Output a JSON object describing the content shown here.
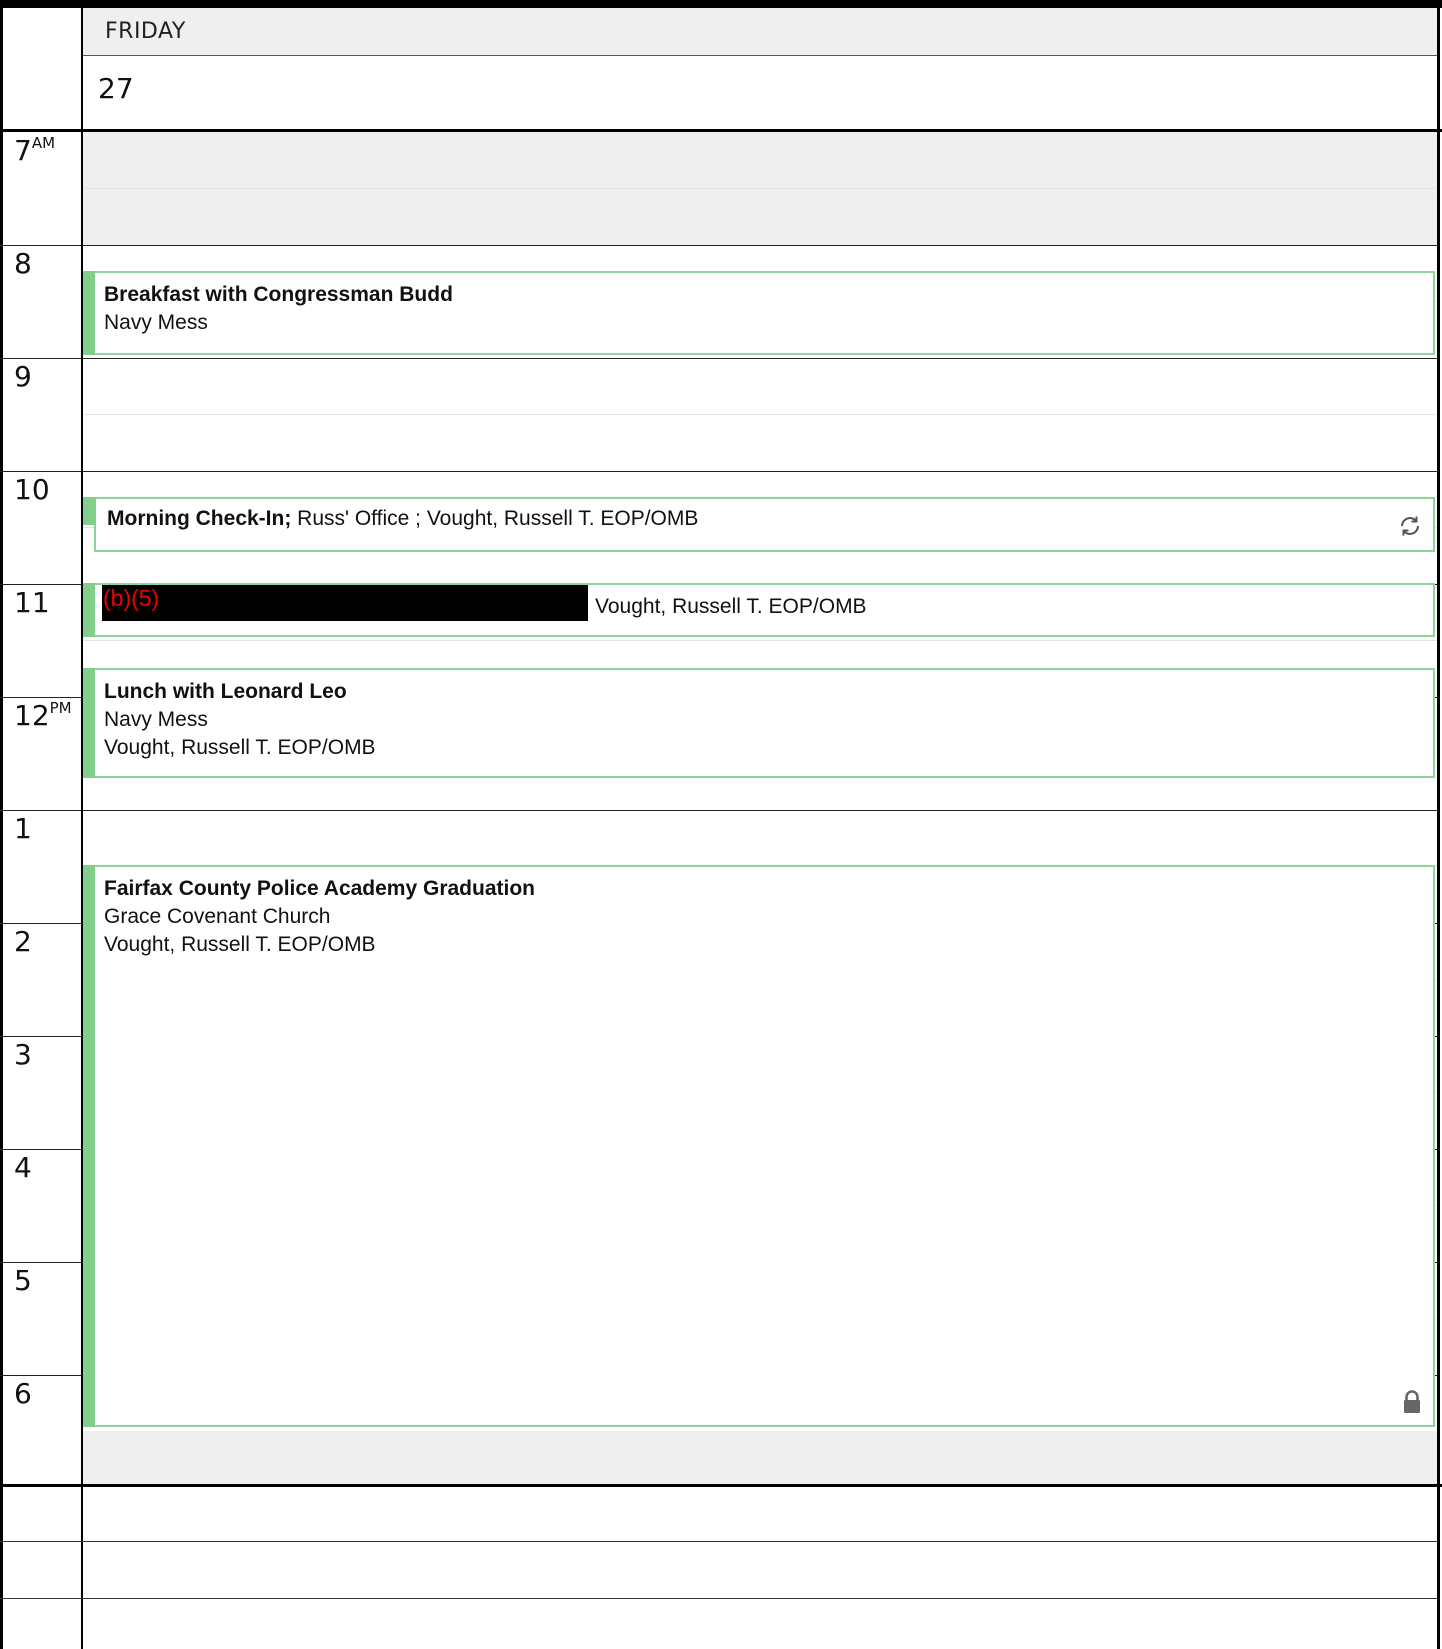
{
  "day": {
    "name": "FRIDAY",
    "date": "27"
  },
  "hours": [
    {
      "label": "7",
      "suffix": "AM"
    },
    {
      "label": "8",
      "suffix": ""
    },
    {
      "label": "9",
      "suffix": ""
    },
    {
      "label": "10",
      "suffix": ""
    },
    {
      "label": "11",
      "suffix": ""
    },
    {
      "label": "12",
      "suffix": "PM"
    },
    {
      "label": "1",
      "suffix": ""
    },
    {
      "label": "2",
      "suffix": ""
    },
    {
      "label": "3",
      "suffix": ""
    },
    {
      "label": "4",
      "suffix": ""
    },
    {
      "label": "5",
      "suffix": ""
    },
    {
      "label": "6",
      "suffix": ""
    }
  ],
  "events": {
    "breakfast": {
      "title": "Breakfast with Congressman Budd",
      "location": "Navy Mess"
    },
    "checkin": {
      "title": "Morning Check-In;",
      "details": " Russ' Office ; Vought, Russell T. EOP/OMB",
      "icon": "recurring-icon"
    },
    "redacted": {
      "redaction_code": "(b)(5)",
      "attendee": "Vought, Russell T. EOP/OMB"
    },
    "lunch": {
      "title": "Lunch with Leonard Leo",
      "location": "Navy Mess",
      "attendee": "Vought, Russell T. EOP/OMB"
    },
    "graduation": {
      "title": "Fairfax County Police Academy Graduation",
      "location": "Grace Covenant Church",
      "attendee": "Vought, Russell T. EOP/OMB",
      "icon": "lock-icon"
    }
  },
  "colors": {
    "event_accent": "#82cf8c",
    "event_border": "#8fd39a",
    "shaded_hour": "#efefef",
    "redaction_text": "#e00000"
  }
}
